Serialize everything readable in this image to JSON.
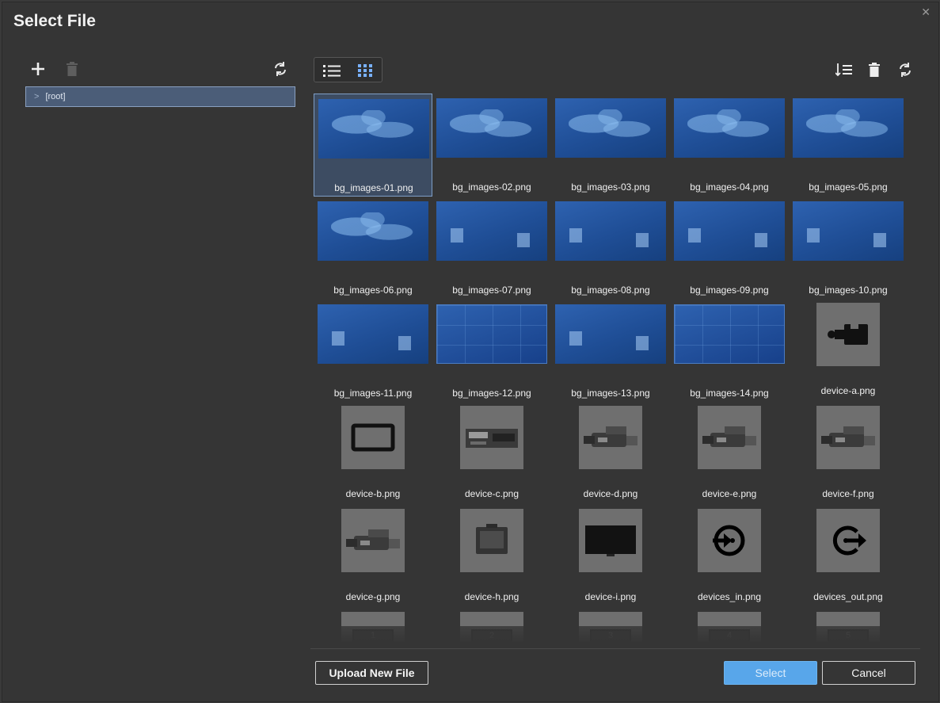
{
  "dialog": {
    "title": "Select File",
    "close_icon": "close-icon"
  },
  "left_panel": {
    "toolbar": {
      "add_icon": "plus-icon",
      "delete_icon": "trash-icon",
      "refresh_icon": "refresh-icon"
    },
    "tree": [
      {
        "label": "[root]",
        "icon": "chevron-right-icon"
      }
    ]
  },
  "right_panel": {
    "view_toggle": {
      "list_icon": "list-view-icon",
      "grid_icon": "grid-view-icon",
      "active": "grid"
    },
    "toolbar": {
      "sort_icon": "sort-icon",
      "delete_icon": "trash-icon",
      "refresh_icon": "refresh-icon"
    },
    "files": [
      {
        "name": "bg_images-01.png",
        "kind": "map",
        "selected": true
      },
      {
        "name": "bg_images-02.png",
        "kind": "map"
      },
      {
        "name": "bg_images-03.png",
        "kind": "map"
      },
      {
        "name": "bg_images-04.png",
        "kind": "map"
      },
      {
        "name": "bg_images-05.png",
        "kind": "map"
      },
      {
        "name": "bg_images-06.png",
        "kind": "map"
      },
      {
        "name": "bg_images-07.png",
        "kind": "panels"
      },
      {
        "name": "bg_images-08.png",
        "kind": "panels"
      },
      {
        "name": "bg_images-09.png",
        "kind": "panels"
      },
      {
        "name": "bg_images-10.png",
        "kind": "panels"
      },
      {
        "name": "bg_images-11.png",
        "kind": "panels"
      },
      {
        "name": "bg_images-12.png",
        "kind": "grid"
      },
      {
        "name": "bg_images-13.png",
        "kind": "panels"
      },
      {
        "name": "bg_images-14.png",
        "kind": "grid"
      },
      {
        "name": "device-a.png",
        "kind": "device",
        "icon": "camera-icon"
      },
      {
        "name": "device-b.png",
        "kind": "device",
        "icon": "monitor-outline-icon"
      },
      {
        "name": "device-c.png",
        "kind": "device",
        "icon": "deck-icon"
      },
      {
        "name": "device-d.png",
        "kind": "device",
        "icon": "camcorder-icon"
      },
      {
        "name": "device-e.png",
        "kind": "device",
        "icon": "camcorder-icon"
      },
      {
        "name": "device-f.png",
        "kind": "device",
        "icon": "camcorder-icon"
      },
      {
        "name": "device-g.png",
        "kind": "device",
        "icon": "camcorder-icon"
      },
      {
        "name": "device-h.png",
        "kind": "device",
        "icon": "field-monitor-icon"
      },
      {
        "name": "device-i.png",
        "kind": "device",
        "icon": "display-icon"
      },
      {
        "name": "devices_in.png",
        "kind": "device",
        "icon": "input-arrow-icon"
      },
      {
        "name": "devices_out.png",
        "kind": "device",
        "icon": "output-arrow-icon"
      }
    ],
    "partial_row": [
      "1",
      "2",
      "3",
      "4",
      "5"
    ]
  },
  "footer": {
    "upload_label": "Upload New File",
    "select_label": "Select",
    "cancel_label": "Cancel"
  }
}
